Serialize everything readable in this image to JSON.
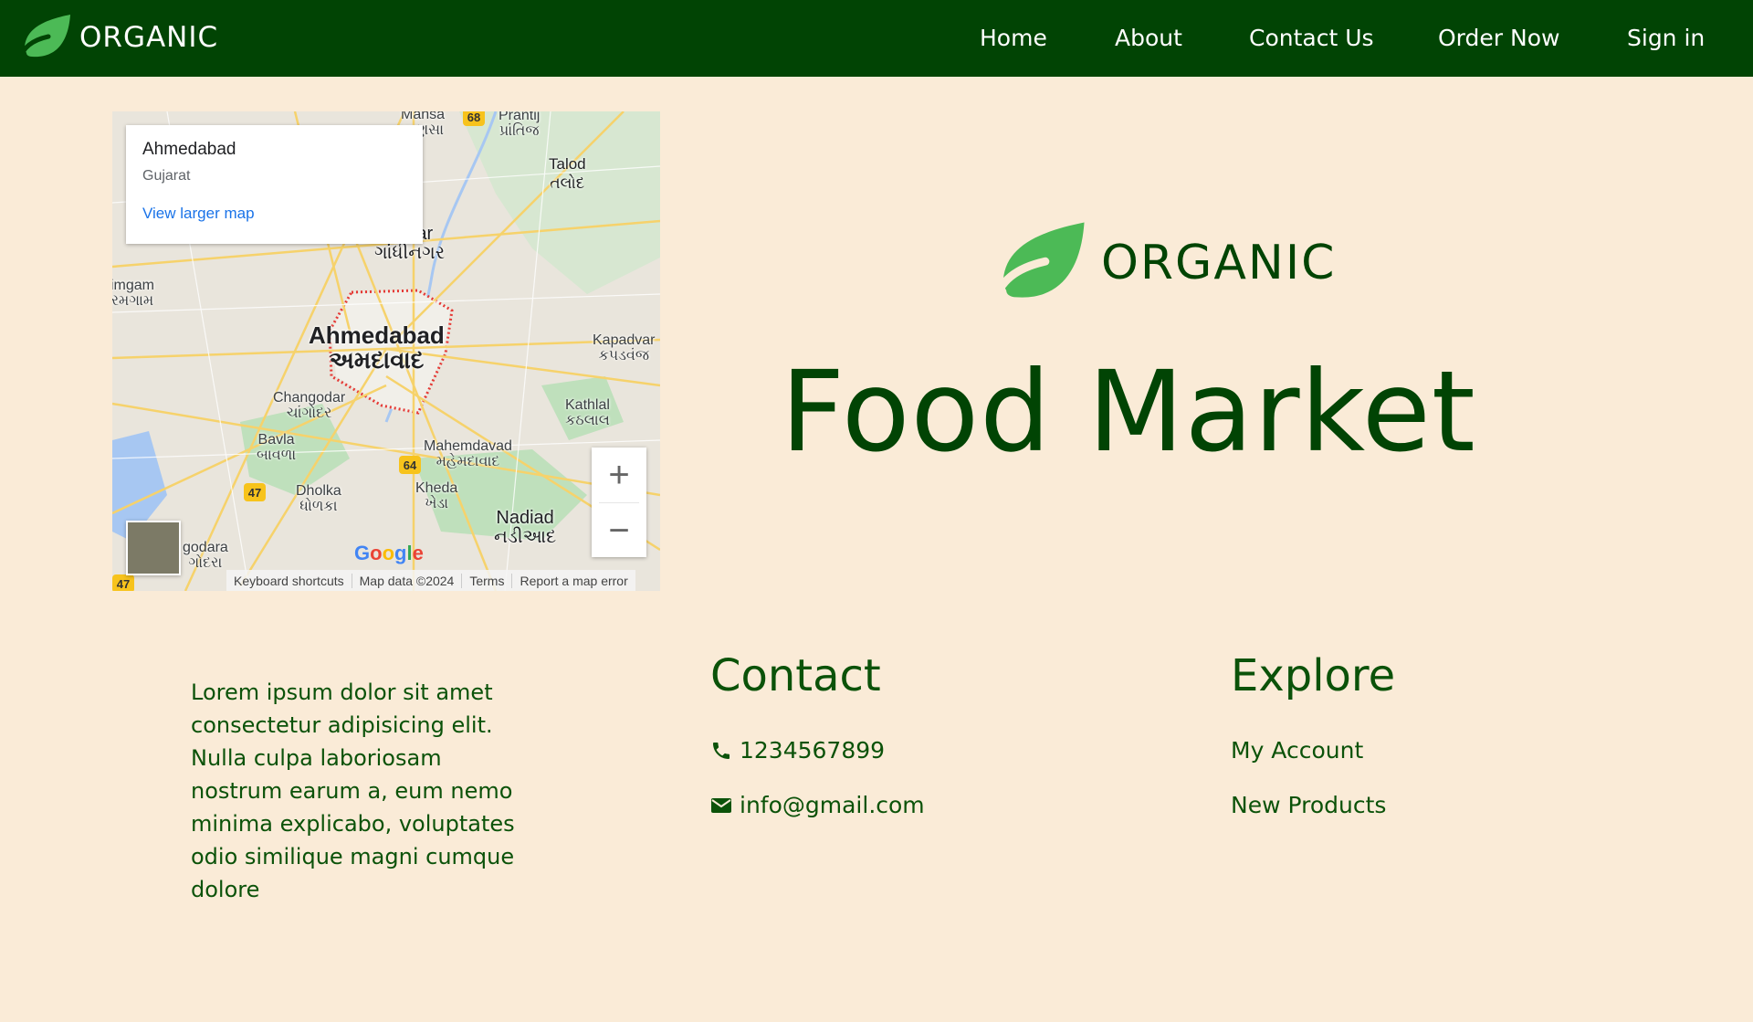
{
  "navbar": {
    "brand": "ORGANIC",
    "links": [
      "Home",
      "About",
      "Contact Us",
      "Order Now",
      "Sign in"
    ],
    "bg_color": "#014404"
  },
  "map": {
    "info_title": "Ahmedabad",
    "info_subtitle": "Gujarat",
    "larger_map_link": "View larger map",
    "labels": {
      "mansa": "Mansa\nમાણસા",
      "prantij": "Prantij\nપ્રાંતિજ",
      "talod": "Talod\nતલોદ",
      "gandhinagar": "nagar\nગાંધીનગર",
      "viramgam": "imgam\nરમગામ",
      "ahmedabad": "Ahmedabad\nઅમદાવાદ",
      "kapadvanj": "Kapadvar\nકપડવંજ",
      "changodar": "Changodar\nચાંગોદર",
      "kathlal": "Kathlal\nકઠલાલ",
      "bavla": "Bavla\nબાવળા",
      "mahemdavad": "Mahemdavad\nમહેમદાવાદ",
      "dholka": "Dholka\nધોળકા",
      "kheda": "Kheda\nખેડા",
      "nadiad": "Nadiad\nનડીઆદ",
      "bagodara": "godara\nગોદરા"
    },
    "road_badges": [
      "68",
      "64",
      "47",
      "47"
    ],
    "zoom_in": "+",
    "zoom_out": "−",
    "google": "Google",
    "footer": [
      "Keyboard shortcuts",
      "Map data ©2024",
      "Terms",
      "Report a map error"
    ]
  },
  "hero": {
    "logo_text": "ORGANIC",
    "title": "Food Market",
    "leaf_color": "#4cba56"
  },
  "footer": {
    "about": "Lorem ipsum dolor sit amet consectetur adipisicing elit. Nulla culpa laboriosam nostrum earum a, eum nemo minima explicabo, voluptates odio similique magni cumque dolore",
    "contact_heading": "Contact",
    "phone": "1234567899",
    "email": "info@gmail.com",
    "explore_heading": "Explore",
    "explore_links": [
      "My Account",
      "New Products"
    ]
  },
  "icons": {
    "leaf": "leaf-icon",
    "phone": "phone-icon",
    "mail": "envelope-icon"
  }
}
